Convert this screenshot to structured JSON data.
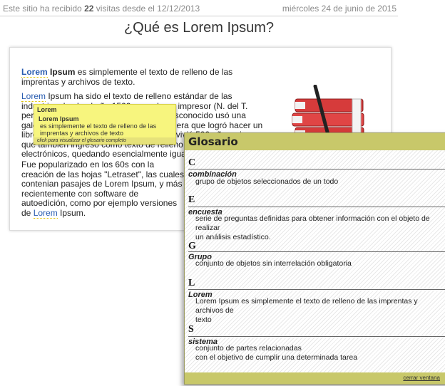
{
  "topbar": {
    "visits_prefix": "Este sitio ha recibido",
    "visits_count": "22",
    "visits_suffix": "visitas desde el 12/12/2013",
    "date": "miércoles 24 de junio de 2015"
  },
  "page": {
    "title": "¿Qué es Lorem Ipsum?"
  },
  "content": {
    "p1_term_a": "Lorem",
    "p1_term_b": "Ipsum",
    "p1_text": " es simplemente el texto de relleno de las imprentas y archivos de texto.",
    "p2_term": "Lorem",
    "p2_text_1": " Ipsum ha sido el texto de relleno estándar de las industrias desde el año 1500, cuando un impresor (N. del T. persona que se dedica a la imprenta) desconocido usó una galería de textos y los mezcló de tal manera que logró hacer un libro de textos especimen. No sólo sobrevivió 500 años, sino que tambien ingresó como texto de relleno en documentos electrónicos,",
    "p2_text_2": "quedando esencialmente igual al original.",
    "p3_text_1": "Fue popularizado en los 60s con la creación de las hojas \"Letraset\", las cuales contenian pasajes de Lorem Ipsum, y más recientemente con software de autoedición, como por ejemplo versiones de ",
    "p3_term": "Lorem",
    "p3_text_2": " Ipsum."
  },
  "tooltip": {
    "title": "Lorem",
    "term": "Lorem Ipsum",
    "definition": "es simplemente el texto de relleno de las imprentas y archivos de texto",
    "footer": "click para visualizar el glosario completo"
  },
  "glossary": {
    "title": "Glosario",
    "sections": [
      {
        "letter": "C",
        "term": "combinación",
        "lines": [
          "grupo de objetos seleccionados de un todo"
        ]
      },
      {
        "letter": "E",
        "term": "encuesta",
        "lines": [
          "serie de preguntas definidas para obtener información con el objeto de realizar",
          "un análisis estadístico."
        ]
      },
      {
        "letter": "G",
        "term": "Grupo",
        "lines": [
          "conjunto de objetos sin interrelación obligatoria"
        ]
      },
      {
        "letter": "L",
        "term": "Lorem",
        "lines": [
          "Lorem Ipsum es simplemente el texto de relleno de las imprentas y archivos de",
          "texto"
        ]
      },
      {
        "letter": "S",
        "term": "sistema",
        "lines": [
          "conjunto de partes relacionadas",
          "con el objetivo de cumplir una determinada tarea"
        ]
      }
    ],
    "close_label": "cerrar ventana"
  },
  "colors": {
    "accent_link": "#2a5db0",
    "tooltip_bg": "#f7f57e",
    "glossary_header": "#c8c86a",
    "binder_red": "#d63b3b"
  },
  "icons": {
    "illustration": "binders-magnifier-icon"
  }
}
